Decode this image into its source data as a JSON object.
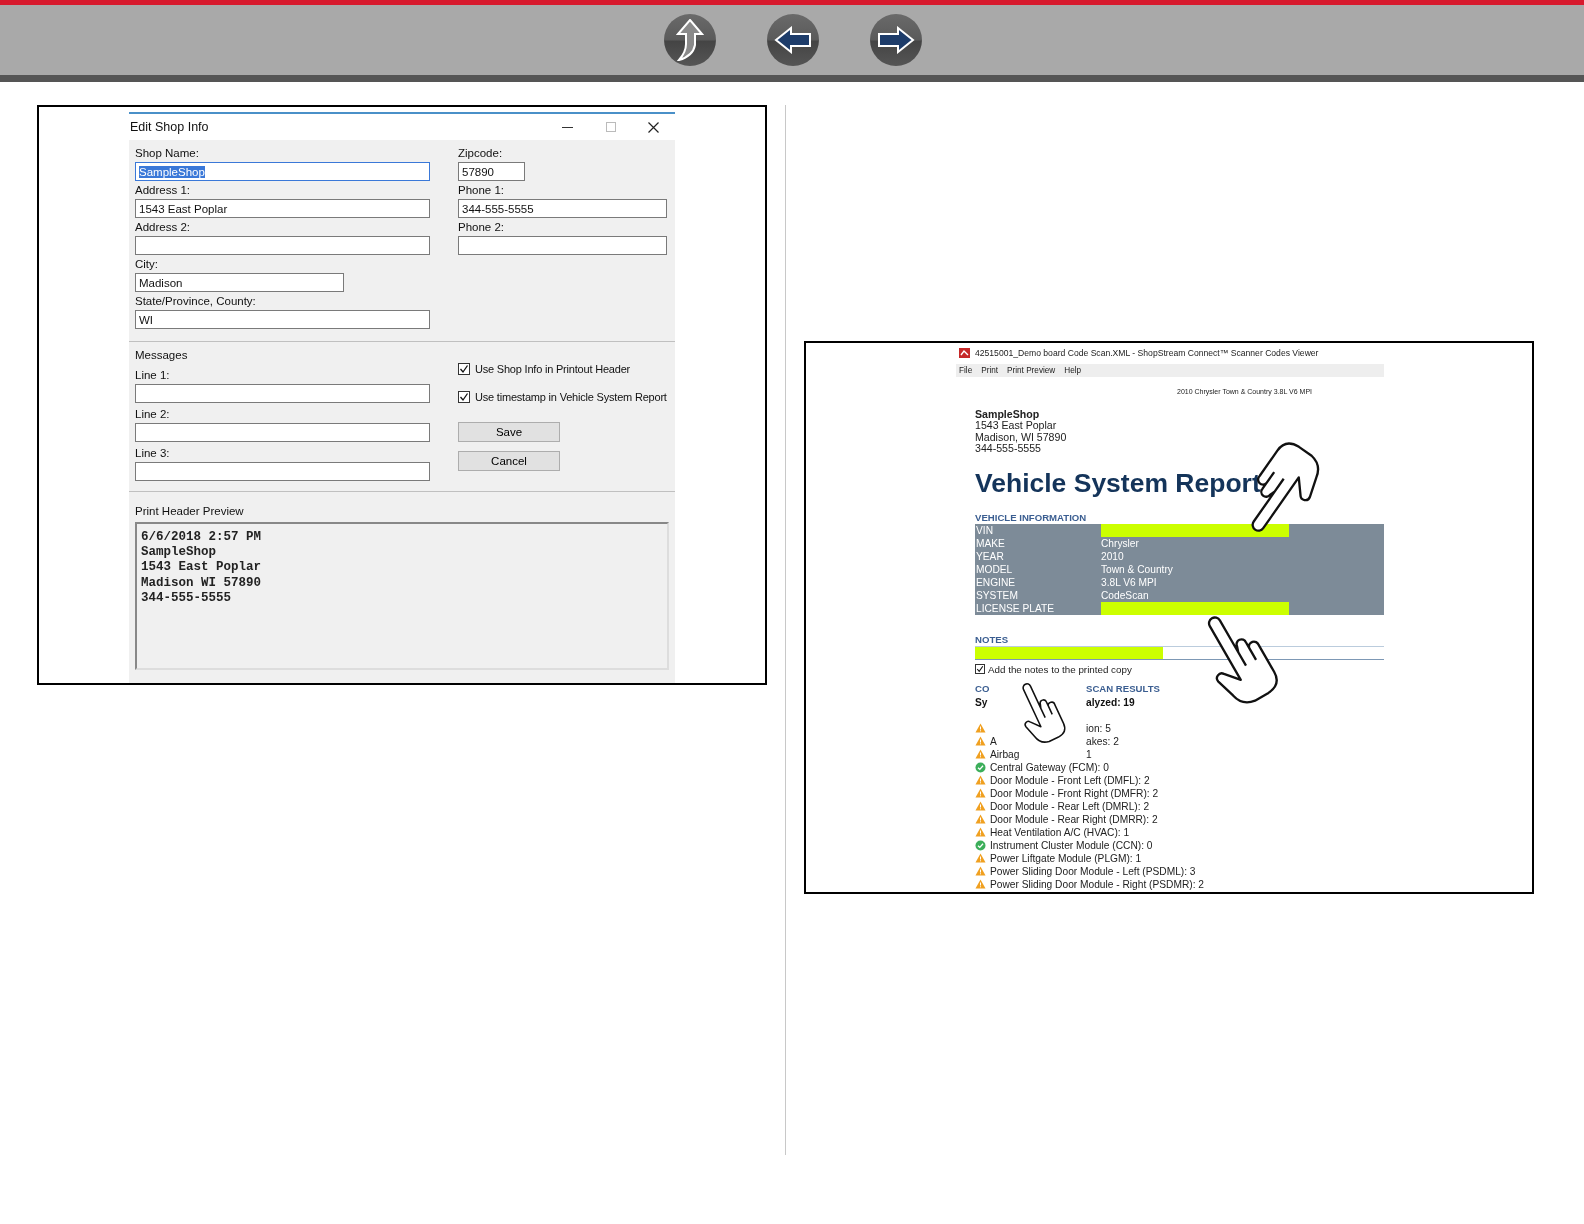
{
  "nav_buttons": [
    {
      "kind": "up"
    },
    {
      "kind": "back"
    },
    {
      "kind": "forward"
    }
  ],
  "edit_shop_dialog": {
    "title": "Edit Shop Info",
    "fields_left": [
      {
        "label": "Shop Name:",
        "value": "SampleShop",
        "focused": true,
        "kind": "long"
      },
      {
        "label": "Address 1:",
        "value": "1543 East Poplar",
        "focused": false,
        "kind": "long"
      },
      {
        "label": "Address 2:",
        "focused": false,
        "kind": "long"
      },
      {
        "label": "City:",
        "value": "Madison",
        "focused": false,
        "kind": "medium"
      },
      {
        "label": "State/Province, County:",
        "value": "WI",
        "focused": false,
        "kind": "long"
      }
    ],
    "fields_right": [
      {
        "label": "Zipcode:",
        "value": "57890",
        "focused": false,
        "kind": "short"
      },
      {
        "label": "Phone 1:",
        "value": "344-555-5555",
        "focused": false,
        "kind": "medium"
      },
      {
        "label": "Phone 2:",
        "focused": false,
        "kind": "medium"
      }
    ],
    "messages": {
      "heading": "Messages",
      "lines": [
        {
          "label": "Line 1:"
        },
        {
          "label": "Line 2:"
        },
        {
          "label": "Line 3:"
        }
      ]
    },
    "checkboxes": [
      {
        "label": "Use Shop Info in Printout Header",
        "checked": true
      },
      {
        "label": "Use timestamp in Vehicle System Report",
        "checked": true
      }
    ],
    "buttons": [
      "Save",
      "Cancel"
    ],
    "preview": {
      "label": "Print Header Preview",
      "lines": [
        "6/6/2018 2:57 PM",
        "SampleShop",
        "1543 East Poplar",
        "Madison WI 57890",
        "344-555-5555"
      ]
    }
  },
  "scanner_viewer": {
    "title": "42515001_Demo board Code Scan.XML - ShopStream Connect™ Scanner Codes Viewer",
    "menu": [
      "File",
      "Print",
      "Print Preview",
      "Help"
    ],
    "vehicle_header": "2010 Chrysler Town & Country 3.8L V6 MPI",
    "shop": {
      "name": "SampleShop",
      "lines": [
        "1543 East Poplar",
        "Madison, WI 57890",
        "344-555-5555"
      ]
    },
    "report_title": "Vehicle System Report",
    "vehicle_info": {
      "heading": "VEHICLE INFORMATION",
      "rows": [
        {
          "label": "VIN",
          "highlighted": true
        },
        {
          "label": "MAKE",
          "value": "Chrysler",
          "highlighted": false
        },
        {
          "label": "YEAR",
          "value": "2010",
          "highlighted": false
        },
        {
          "label": "MODEL",
          "value": "Town & Country",
          "highlighted": false
        },
        {
          "label": "ENGINE",
          "value": "3.8L V6 MPI",
          "highlighted": false
        },
        {
          "label": "SYSTEM",
          "value": "CodeScan",
          "highlighted": false
        },
        {
          "label": "LICENSE PLATE",
          "highlighted": true
        }
      ]
    },
    "notes": {
      "heading": "NOTES",
      "highlighted": true
    },
    "notes_checkbox": {
      "label": "Add the notes to the printed copy",
      "checked": true
    },
    "results_heading": {
      "before": "CO",
      "after": "SCAN RESULTS"
    },
    "systems_analyzed": {
      "before": "Sy",
      "after": "alyzed: 19"
    },
    "covered_systems": [
      {
        "kind": "warning",
        "after": "ion: 5"
      },
      {
        "kind": "warning",
        "before": "A",
        "after": "akes: 2"
      },
      {
        "kind": "warning",
        "before": "Airbag",
        "after": "1"
      }
    ],
    "systems": [
      {
        "kind": "ok",
        "text": "Central Gateway (FCM): 0"
      },
      {
        "kind": "warning",
        "text": "Door Module - Front Left (DMFL): 2"
      },
      {
        "kind": "warning",
        "text": "Door Module - Front Right (DMFR): 2"
      },
      {
        "kind": "warning",
        "text": "Door Module - Rear Left (DMRL): 2"
      },
      {
        "kind": "warning",
        "text": "Door Module - Rear Right (DMRR): 2"
      },
      {
        "kind": "warning",
        "text": "Heat Ventilation A/C (HVAC): 1"
      },
      {
        "kind": "ok",
        "text": "Instrument Cluster Module (CCN): 0"
      },
      {
        "kind": "warning",
        "text": "Power Liftgate Module (PLGM): 1"
      },
      {
        "kind": "warning",
        "text": "Power Sliding Door Module - Left (PSDML): 3"
      },
      {
        "kind": "warning",
        "text": "Power Sliding Door Module - Right (PSDMR): 2"
      }
    ]
  }
}
